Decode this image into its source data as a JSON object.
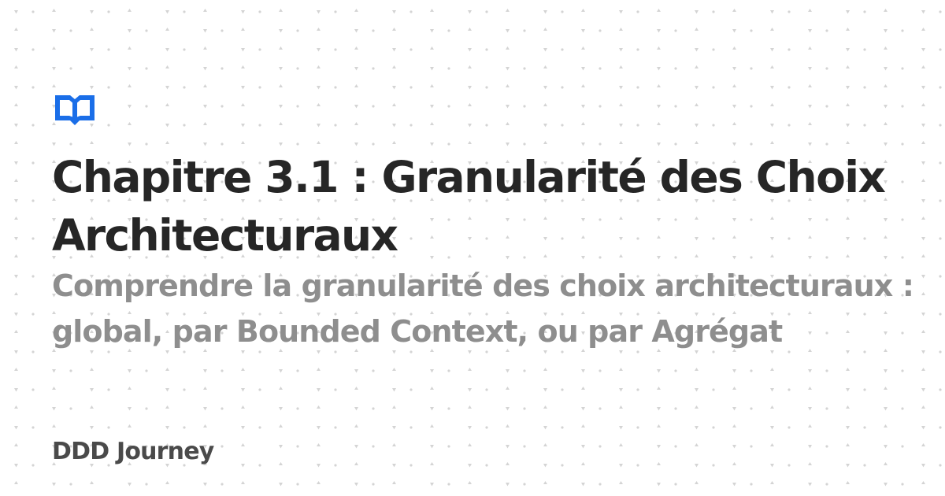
{
  "card": {
    "logo_icon": "open-book-icon",
    "title": "Chapitre 3.1 : Granularité des Choix Architecturaux",
    "subtitle": "Comprendre la granularité des choix architecturaux : global, par Bounded Context, ou par Agrégat",
    "site_name": "DDD Journey"
  },
  "colors": {
    "background": "#ffffff",
    "dot_pattern": "#d9d9d9",
    "logo": "#1a6ee8",
    "title": "#262626",
    "subtitle": "#8e8e8e",
    "site_name": "#4a4a4a"
  }
}
